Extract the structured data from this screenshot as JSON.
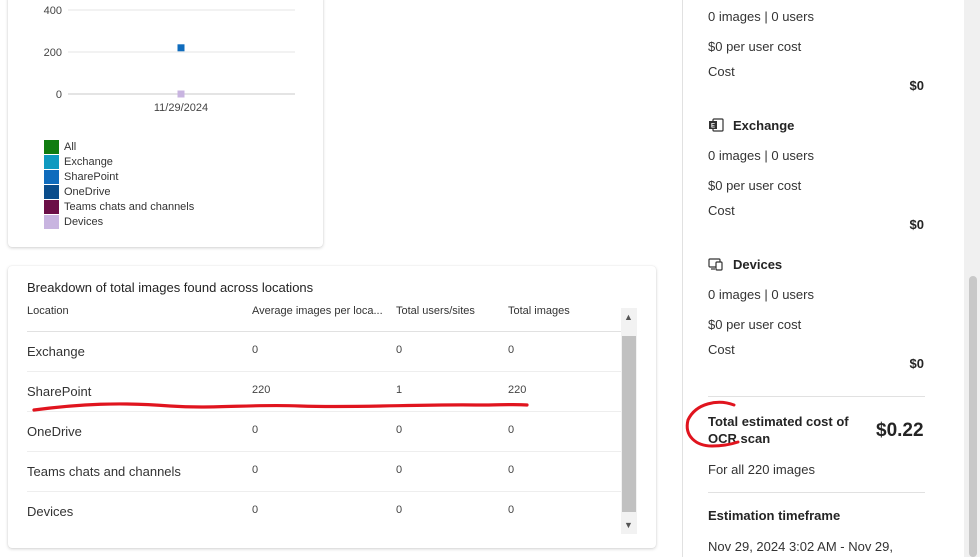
{
  "chart_data": {
    "type": "scatter",
    "x_categories": [
      "11/29/2024"
    ],
    "yticks": [
      0,
      200,
      400
    ],
    "ylim": [
      0,
      420
    ],
    "series": [
      {
        "name": "All",
        "color": "#107c10",
        "values": [
          0
        ]
      },
      {
        "name": "Exchange",
        "color": "#0f9ac0",
        "values": [
          0
        ]
      },
      {
        "name": "SharePoint",
        "color": "#0f6cbd",
        "values": [
          220
        ]
      },
      {
        "name": "OneDrive",
        "color": "#0a4d8c",
        "values": [
          0
        ]
      },
      {
        "name": "Teams chats and channels",
        "color": "#6b0f47",
        "values": [
          0
        ]
      },
      {
        "name": "Devices",
        "color": "#c8b4e0",
        "values": [
          0
        ]
      }
    ]
  },
  "table": {
    "title": "Breakdown of total images found across locations",
    "columns": [
      "Location",
      "Average images per loca...",
      "Total users/sites",
      "Total images"
    ],
    "rows": [
      {
        "location": "Exchange",
        "avg": "0",
        "users": "0",
        "images": "0"
      },
      {
        "location": "SharePoint",
        "avg": "220",
        "users": "1",
        "images": "220"
      },
      {
        "location": "OneDrive",
        "avg": "0",
        "users": "0",
        "images": "0"
      },
      {
        "location": "Teams chats and channels",
        "avg": "0",
        "users": "0",
        "images": "0"
      },
      {
        "location": "Devices",
        "avg": "0",
        "users": "0",
        "images": "0"
      }
    ],
    "scroll_up": "▲",
    "scroll_down": "▼"
  },
  "right_panel": {
    "top_block": {
      "summary": "0 images | 0 users",
      "per_user": "$0 per user cost",
      "cost_label": "Cost",
      "cost_value": "$0"
    },
    "exchange": {
      "title": "Exchange",
      "icon": "exchange-icon",
      "summary": "0 images | 0 users",
      "per_user": "$0 per user cost",
      "cost_label": "Cost",
      "cost_value": "$0"
    },
    "devices": {
      "title": "Devices",
      "icon": "devices-icon",
      "summary": "0 images | 0 users",
      "per_user": "$0 per user cost",
      "cost_label": "Cost",
      "cost_value": "$0"
    },
    "total": {
      "label": "Total estimated cost of OCR scan",
      "value": "$0.22",
      "sub": "For all 220 images"
    },
    "timeframe": {
      "title": "Estimation timeframe",
      "value": "Nov 29, 2024 3:02 AM - Nov 29,"
    }
  },
  "annotation_color": "#e0141e"
}
